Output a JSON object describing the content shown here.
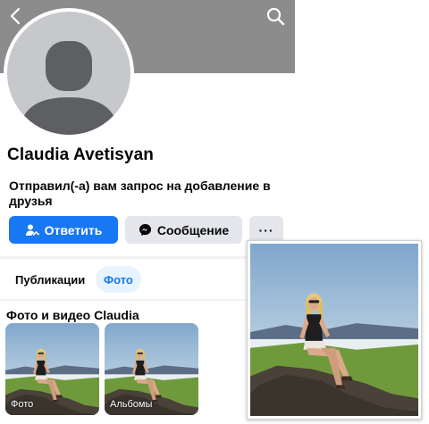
{
  "profile": {
    "name": "Claudia Avetisyan",
    "request_text": "Отправил(-а) вам запрос на добавление в друзья"
  },
  "actions": {
    "reply_label": "Ответить",
    "message_label": "Сообщение",
    "more_label": "···"
  },
  "tabs": [
    {
      "label": "Публикации",
      "active": false
    },
    {
      "label": "Фото",
      "active": true
    }
  ],
  "photos_section": {
    "title": "Фото и видео Claudia",
    "albums": [
      {
        "label": "Фото"
      },
      {
        "label": "Альбомы"
      }
    ]
  },
  "icons": {
    "back": "chevron-left-icon",
    "search": "search-icon",
    "reply": "person-reply-icon",
    "message": "messenger-icon",
    "more": "more-horizontal-icon"
  },
  "colors": {
    "accent": "#1877f2",
    "cover": "#8c8c8c",
    "button_secondary": "#e4e6eb",
    "avatar_placeholder": "#c7c8cc",
    "tab_active_bg": "#e7f3ff"
  }
}
